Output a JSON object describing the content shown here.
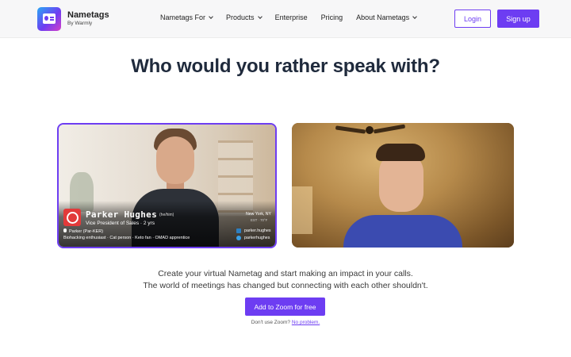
{
  "nav": {
    "logo_name": "Nametags",
    "logo_sub": "By Warmly",
    "menu": [
      {
        "label": "Nametags For",
        "has_dropdown": true
      },
      {
        "label": "Products",
        "has_dropdown": true
      },
      {
        "label": "Enterprise",
        "has_dropdown": false
      },
      {
        "label": "Pricing",
        "has_dropdown": false
      },
      {
        "label": "About Nametags",
        "has_dropdown": true
      }
    ],
    "login_label": "Login",
    "signup_label": "Sign up",
    "accent_color": "#6d3df2"
  },
  "hero": {
    "headline": "Who would you rather speak with?"
  },
  "video_left": {
    "name": "Parker Hughes",
    "pronouns": "(he/him)",
    "title": "Vice President of Sales · 2 yrs",
    "location": "New York, NY",
    "time": "EST · 70°F",
    "pronunciation": "Parker (Par-KER)",
    "facts": "Biohacking enthusiast · Cat person · Keto fan · OMAD apprentice",
    "linkedin": "parker.hughes",
    "twitter": "parkerhughes",
    "badge_color": "#e23a3a"
  },
  "bottom": {
    "line1": "Create your virtual Nametag and start making an impact in your calls.",
    "line2": "The world of meetings has changed but connecting with each other shouldn't.",
    "cta_label": "Add to Zoom for free",
    "alt_prefix": "Don't use Zoom?",
    "alt_link": "No problem."
  }
}
